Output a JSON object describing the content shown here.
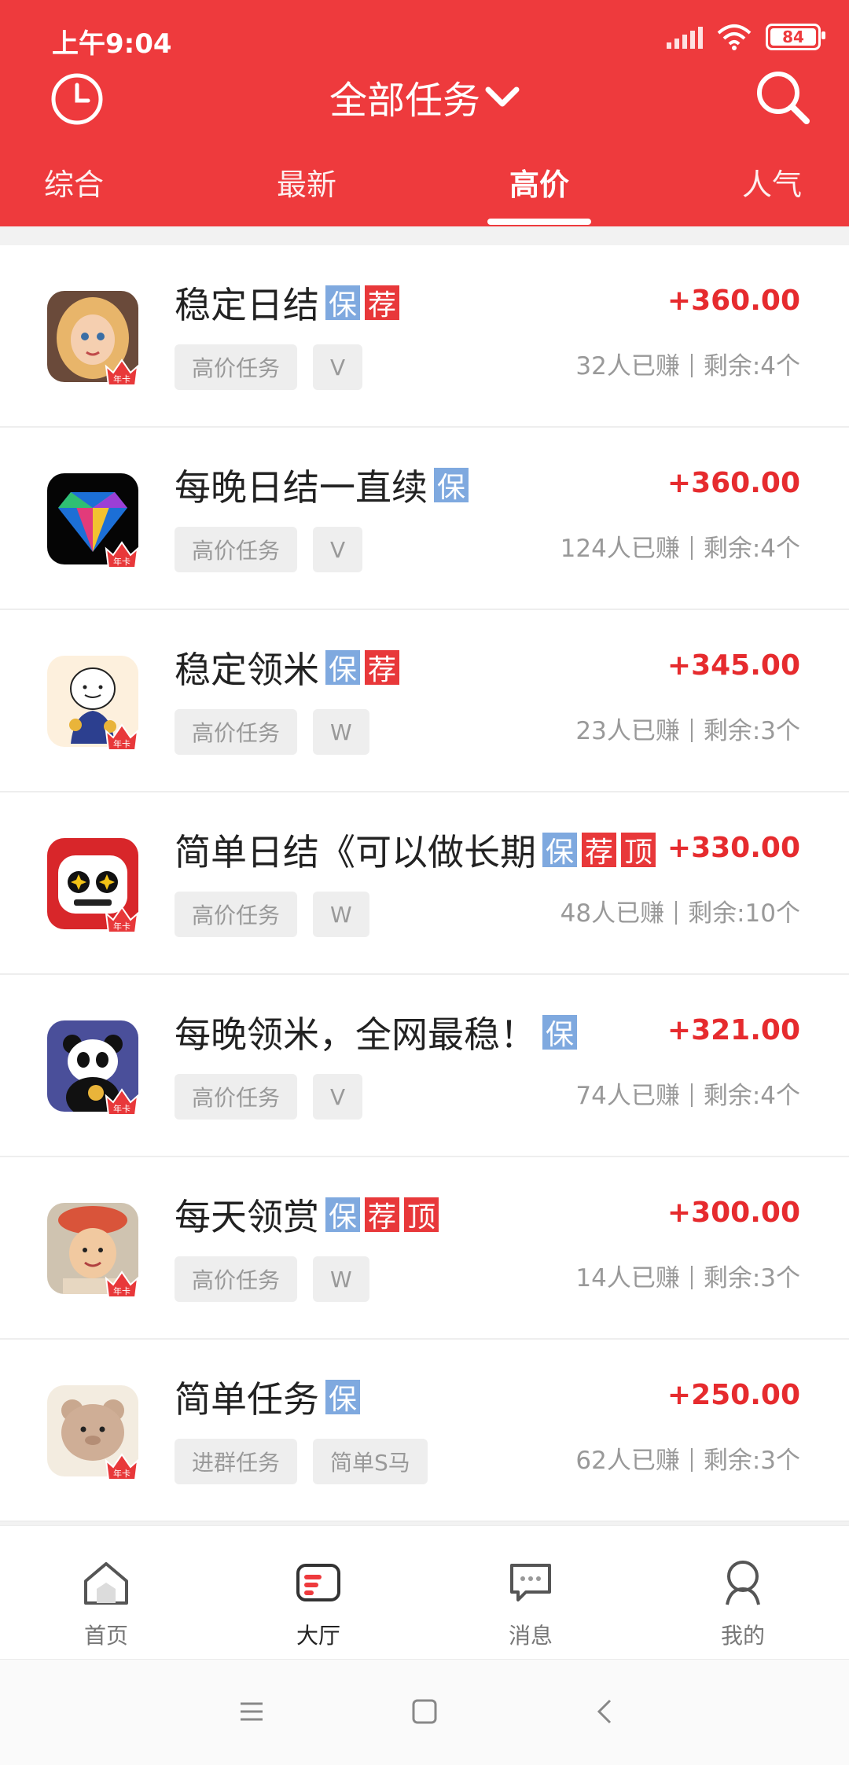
{
  "status_bar": {
    "time": "上午9:04",
    "battery": "84"
  },
  "header": {
    "title": "全部任务"
  },
  "tabs": [
    {
      "label": "综合"
    },
    {
      "label": "最新"
    },
    {
      "label": "高价"
    },
    {
      "label": "人气"
    }
  ],
  "active_tab": "高价",
  "tasks": [
    {
      "title": "稳定日结",
      "badges": [
        "保",
        "荐"
      ],
      "tags": [
        "高价任务",
        "V"
      ],
      "price": "+360.00",
      "earned": "32人已赚",
      "remaining": "剩余:4个"
    },
    {
      "title": "每晚日结一直续",
      "badges": [
        "保"
      ],
      "tags": [
        "高价任务",
        "V"
      ],
      "price": "+360.00",
      "earned": "124人已赚",
      "remaining": "剩余:4个"
    },
    {
      "title": "稳定领米",
      "badges": [
        "保",
        "荐"
      ],
      "tags": [
        "高价任务",
        "W"
      ],
      "price": "+345.00",
      "earned": "23人已赚",
      "remaining": "剩余:3个"
    },
    {
      "title": "简单日结《可以做长期",
      "badges": [
        "保",
        "荐",
        "顶"
      ],
      "tags": [
        "高价任务",
        "W"
      ],
      "price": "+330.00",
      "earned": "48人已赚",
      "remaining": "剩余:10个"
    },
    {
      "title": "每晚领米，全网最稳！",
      "badges": [
        "保"
      ],
      "tags": [
        "高价任务",
        "V"
      ],
      "price": "+321.00",
      "earned": "74人已赚",
      "remaining": "剩余:4个"
    },
    {
      "title": "每天领赏",
      "badges": [
        "保",
        "荐",
        "顶"
      ],
      "tags": [
        "高价任务",
        "W"
      ],
      "price": "+300.00",
      "earned": "14人已赚",
      "remaining": "剩余:3个"
    },
    {
      "title": "简单任务",
      "badges": [
        "保"
      ],
      "tags": [
        "进群任务",
        "简单S马"
      ],
      "price": "+250.00",
      "earned": "62人已赚",
      "remaining": "剩余:3个"
    }
  ],
  "avatar_badge_text": "年卡",
  "bottom_nav": [
    {
      "label": "首页"
    },
    {
      "label": "大厅"
    },
    {
      "label": "消息"
    },
    {
      "label": "我的"
    }
  ],
  "active_nav": "大厅",
  "colors": {
    "brand_red": "#ee3a3d",
    "price_red": "#e62b2e",
    "bao_blue": "#7fa9df"
  },
  "icons": {
    "history": "clock-icon",
    "dropdown": "chevron-down-icon",
    "search": "search-icon",
    "nav": [
      "home-icon",
      "hall-icon",
      "message-icon",
      "profile-icon"
    ],
    "system": [
      "menu-icon",
      "square-icon",
      "back-icon"
    ]
  }
}
